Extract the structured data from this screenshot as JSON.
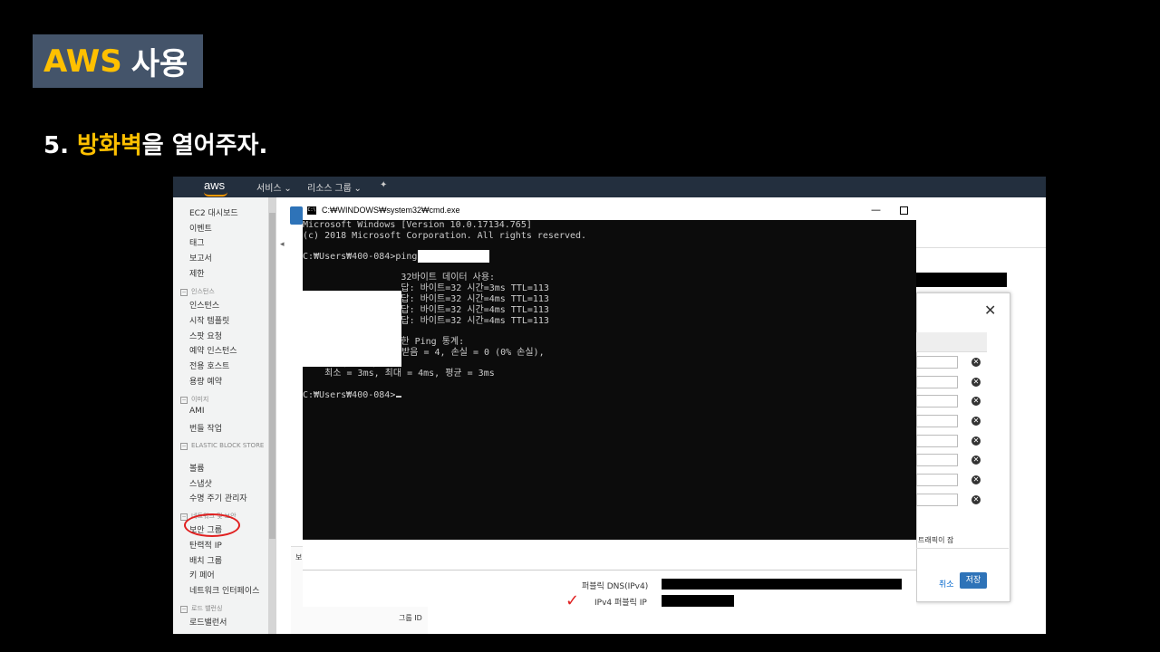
{
  "slide": {
    "title_aws": "AWS",
    "title_rest": "사용",
    "step_num": "5.",
    "step_highlight": "방화벽",
    "step_rest": "을 열어주자."
  },
  "aws_console": {
    "logo": "aws",
    "nav": [
      "서비스 ⌄",
      "리소스 그룹 ⌄"
    ],
    "sidebar": {
      "top_items": [
        "EC2 대시보드",
        "이벤트",
        "태그",
        "보고서",
        "제한"
      ],
      "sections": [
        {
          "heading": "인스턴스",
          "items": [
            "인스턴스",
            "시작 템플릿",
            "스팟 요청",
            "예약 인스턴스",
            "전용 호스트",
            "용량 예약"
          ]
        },
        {
          "heading": "이미지",
          "items": [
            "AMI",
            "번들 작업"
          ]
        },
        {
          "heading": "ELASTIC BLOCK STORE",
          "items": [
            "볼륨",
            "스냅샷",
            "수명 주기 관리자"
          ]
        },
        {
          "heading": "네트워크 및 보안",
          "items": [
            "보안 그룹",
            "탄력적 IP",
            "배치 그룹",
            "키 페어",
            "네트워크 인터페이스"
          ]
        },
        {
          "heading": "로드 밸런싱",
          "items": [
            "로드밸런서"
          ]
        }
      ]
    },
    "lower_label": "보",
    "group_id_label": "그룹 ID",
    "dialog": {
      "note": "트래픽이 잠",
      "cancel": "취소",
      "save": "저장",
      "rows": 8
    },
    "instance": {
      "public_dns_label": "퍼블릭 DNS(IPv4)",
      "public_ip_label": "IPv4 퍼블릭 IP"
    }
  },
  "cmd": {
    "title": "C:₩WINDOWS₩system32₩cmd.exe",
    "lines": [
      "Microsoft Windows [Version 10.0.17134.765]",
      "(c) 2018 Microsoft Corporation. All rights reserved.",
      "",
      "C:₩Users₩400-084>ping",
      "",
      "                  32바이트 데이터 사용:",
      "                  답: 바이트=32 시간=3ms TTL=113",
      "                  답: 바이트=32 시간=4ms TTL=113",
      "                  답: 바이트=32 시간=4ms TTL=113",
      "                  답: 바이트=32 시간=4ms TTL=113",
      "",
      "                  한 Ping 통계:",
      "    패킷: 보냄 = 4, 받음 = 4, 손실 = 0 (0% 손실),",
      "왕복 시간(밀리초):",
      "    최소 = 3ms, 최대 = 4ms, 평균 = 3ms",
      "",
      "C:₩Users₩400-084>"
    ]
  }
}
